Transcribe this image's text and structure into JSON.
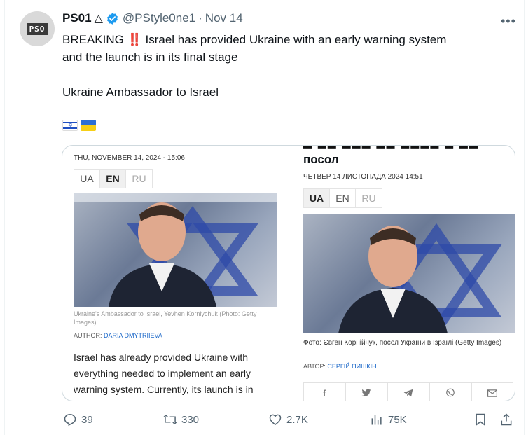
{
  "tweet": {
    "display_name": "PS01",
    "name_symbol": "△",
    "handle": "@PStyle0ne1",
    "separator": "·",
    "date": "Nov 14",
    "avatar_text": "PSO",
    "more_icon": "more-dots-icon",
    "text_breaking_prefix": "BREAKING",
    "text_breaking_marks": "‼️",
    "text_line1_rest": "Israel has provided Ukraine with an early warning system",
    "text_line2": "and the launch is in its final stage",
    "text_source": "Ukraine Ambassador to Israel",
    "flags": [
      "israel-flag-icon",
      "ukraine-flag-icon"
    ]
  },
  "left_article": {
    "date": "THU, NOVEMBER 14, 2024 - 15:06",
    "languages": [
      "UA",
      "EN",
      "RU"
    ],
    "active_language": "EN",
    "caption": "Ukraine's Ambassador to Israel, Yevhen Korniychuk (Photo: Getty Images)",
    "author_label": "AUTHOR:",
    "author_name": "DARIA DMYTRIIEVA",
    "body": "Israel has already provided Ukraine with everything needed to implement an early warning system. Currently, its launch is in"
  },
  "right_article": {
    "title_fragment": "посол",
    "date": "ЧЕТВЕР 14 ЛИСТОПАДА 2024 14:51",
    "languages": [
      "UA",
      "EN",
      "RU"
    ],
    "active_language": "UA",
    "caption": "Фото: Євген Корнійчук, посол України в Ізраїлі (Getty Images)",
    "author_label": "АВТОР:",
    "author_name": "СЕРГІЙ ПИШКІН",
    "share_icons": [
      "facebook-icon",
      "twitter-icon",
      "telegram-icon",
      "viber-icon",
      "email-icon"
    ]
  },
  "actions": {
    "replies": "39",
    "reposts": "330",
    "likes": "2.7K",
    "views": "75K"
  },
  "colors": {
    "verified": "#1d9bf0",
    "secondary_text": "#536471",
    "link_blue": "#1a67c8",
    "breaking_red": "#d62b1f"
  }
}
